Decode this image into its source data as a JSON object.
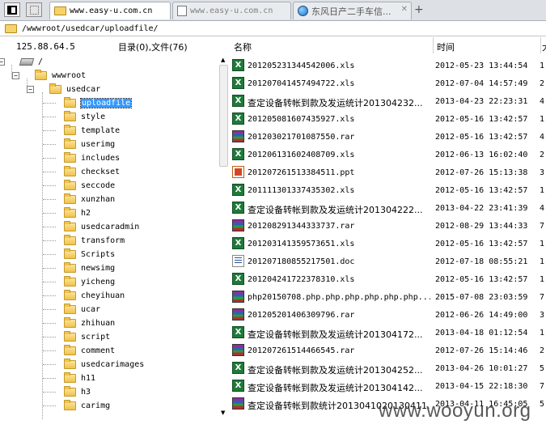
{
  "tabs": [
    {
      "text": "www.easy-u.com.cn",
      "state": "active",
      "icon": "folder-icon"
    },
    {
      "text": "www.easy-u.com.cn",
      "state": "inactive",
      "icon": "page-icon"
    },
    {
      "text": "东风日产二手车信...",
      "state": "inactive",
      "icon": "globe-icon"
    }
  ],
  "new_tab": "+",
  "address": "/wwwroot/usedcar/uploadfile/",
  "server_ip": "125.88.64.5",
  "counts": "目录(0),文件(76)",
  "columns": {
    "name": "名称",
    "time": "时间",
    "size": "大"
  },
  "tree": [
    {
      "label": "/",
      "level": 0,
      "icon": "drive-icon",
      "expander": "−"
    },
    {
      "label": "wwwroot",
      "level": 1,
      "icon": "folder-icon",
      "expander": "−"
    },
    {
      "label": "usedcar",
      "level": 2,
      "icon": "folder-icon",
      "expander": "−"
    },
    {
      "label": "uploadfile",
      "level": 3,
      "icon": "folder-icon",
      "selected": true
    },
    {
      "label": "style",
      "level": 3,
      "icon": "folder-icon"
    },
    {
      "label": "template",
      "level": 3,
      "icon": "folder-icon"
    },
    {
      "label": "userimg",
      "level": 3,
      "icon": "folder-icon"
    },
    {
      "label": "includes",
      "level": 3,
      "icon": "folder-icon"
    },
    {
      "label": "checkset",
      "level": 3,
      "icon": "folder-icon"
    },
    {
      "label": "seccode",
      "level": 3,
      "icon": "folder-icon"
    },
    {
      "label": "xunzhan",
      "level": 3,
      "icon": "folder-icon"
    },
    {
      "label": "h2",
      "level": 3,
      "icon": "folder-icon"
    },
    {
      "label": "usedcaradmin",
      "level": 3,
      "icon": "folder-icon"
    },
    {
      "label": "transform",
      "level": 3,
      "icon": "folder-icon"
    },
    {
      "label": "Scripts",
      "level": 3,
      "icon": "folder-icon"
    },
    {
      "label": "newsimg",
      "level": 3,
      "icon": "folder-icon"
    },
    {
      "label": "yicheng",
      "level": 3,
      "icon": "folder-icon"
    },
    {
      "label": "cheyihuan",
      "level": 3,
      "icon": "folder-icon"
    },
    {
      "label": "ucar",
      "level": 3,
      "icon": "folder-icon"
    },
    {
      "label": "zhihuan",
      "level": 3,
      "icon": "folder-icon"
    },
    {
      "label": "script",
      "level": 3,
      "icon": "folder-icon"
    },
    {
      "label": "comment",
      "level": 3,
      "icon": "folder-icon"
    },
    {
      "label": "usedcarimages",
      "level": 3,
      "icon": "folder-icon"
    },
    {
      "label": "h11",
      "level": 3,
      "icon": "folder-icon"
    },
    {
      "label": "h3",
      "level": 3,
      "icon": "folder-icon"
    },
    {
      "label": "carimg",
      "level": 3,
      "icon": "folder-icon"
    }
  ],
  "files": [
    {
      "name": "201205231344542006.xls",
      "type": "xls",
      "time": "2012-05-23 13:44:54",
      "size": "1"
    },
    {
      "name": "201207041457494722.xls",
      "type": "xls",
      "time": "2012-07-04 14:57:49",
      "size": "2"
    },
    {
      "name": "查定设备转帐到款及发运统计201304232...",
      "type": "xls",
      "time": "2013-04-23 22:23:31",
      "size": "4"
    },
    {
      "name": "201205081607435927.xls",
      "type": "xls",
      "time": "2012-05-16 13:42:57",
      "size": "1"
    },
    {
      "name": "201203021701087550.rar",
      "type": "rar",
      "time": "2012-05-16 13:42:57",
      "size": "4"
    },
    {
      "name": "201206131602408709.xls",
      "type": "xls",
      "time": "2012-06-13 16:02:40",
      "size": "2"
    },
    {
      "name": "201207261513384511.ppt",
      "type": "ppt",
      "time": "2012-07-26 15:13:38",
      "size": "3"
    },
    {
      "name": "201111301337435302.xls",
      "type": "xls",
      "time": "2012-05-16 13:42:57",
      "size": "1"
    },
    {
      "name": "查定设备转帐到款及发运统计201304222...",
      "type": "xls",
      "time": "2013-04-22 23:41:39",
      "size": "4"
    },
    {
      "name": "201208291344333737.rar",
      "type": "rar",
      "time": "2012-08-29 13:44:33",
      "size": "7"
    },
    {
      "name": "201203141359573651.xls",
      "type": "xls",
      "time": "2012-05-16 13:42:57",
      "size": "1"
    },
    {
      "name": "201207180855217501.doc",
      "type": "doc",
      "time": "2012-07-18 08:55:21",
      "size": "1"
    },
    {
      "name": "201204241722378310.xls",
      "type": "xls",
      "time": "2012-05-16 13:42:57",
      "size": "1"
    },
    {
      "name": "php20150708.php.php.php.php.php.php...",
      "type": "rar",
      "time": "2015-07-08 23:03:59",
      "size": "7"
    },
    {
      "name": "201205201406309796.rar",
      "type": "rar",
      "time": "2012-06-26 14:49:00",
      "size": "3"
    },
    {
      "name": "查定设备转帐到款及发运统计201304172...",
      "type": "xls",
      "time": "2013-04-18 01:12:54",
      "size": "1"
    },
    {
      "name": "201207261514466545.rar",
      "type": "rar",
      "time": "2012-07-26 15:14:46",
      "size": "2"
    },
    {
      "name": "查定设备转帐到款及发运统计201304252...",
      "type": "xls",
      "time": "2013-04-26 10:01:27",
      "size": "5"
    },
    {
      "name": "查定设备转帐到款及发运统计201304142...",
      "type": "xls",
      "time": "2013-04-15 22:18:30",
      "size": "7"
    },
    {
      "name": "查定设备转帐到款统计2013041020130411...",
      "type": "rar",
      "time": "2013-04-11 16:45:05",
      "size": "5"
    }
  ],
  "watermark": "www.wooyun.org"
}
